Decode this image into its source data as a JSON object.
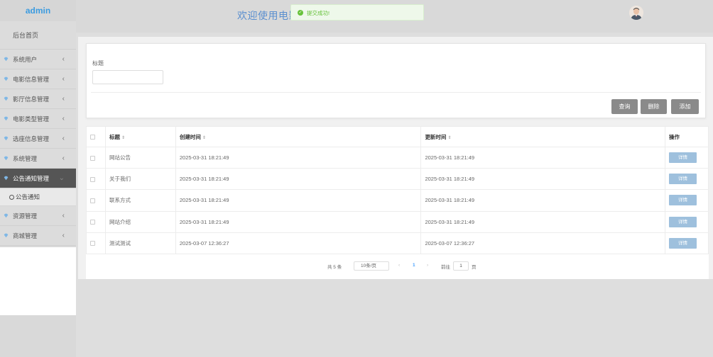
{
  "app": {
    "logo": "admin",
    "welcome": "欢迎使用电影"
  },
  "toast": {
    "message": "提交成功!"
  },
  "sidebar": {
    "home": "后台首页",
    "items": [
      {
        "label": "系统用户"
      },
      {
        "label": "电影信息管理"
      },
      {
        "label": "影厅信息管理"
      },
      {
        "label": "电影类型管理"
      },
      {
        "label": "选座信息管理"
      },
      {
        "label": "系统管理"
      },
      {
        "label": "公告通知管理",
        "active": true
      },
      {
        "label": "资源管理"
      },
      {
        "label": "商城管理"
      }
    ],
    "sub_item": "公告通知"
  },
  "search": {
    "label": "标题",
    "value": "",
    "buttons": {
      "query": "查询",
      "delete": "删除",
      "add": "添加"
    }
  },
  "table": {
    "columns": {
      "title": "标题",
      "created": "创建时间",
      "updated": "更新时间",
      "actions": "操作"
    },
    "rows": [
      {
        "title": "网站公告",
        "created": "2025-03-31 18:21:49",
        "updated": "2025-03-31 18:21:49",
        "action": "详情"
      },
      {
        "title": "关于我们",
        "created": "2025-03-31 18:21:49",
        "updated": "2025-03-31 18:21:49",
        "action": "详情"
      },
      {
        "title": "联系方式",
        "created": "2025-03-31 18:21:49",
        "updated": "2025-03-31 18:21:49",
        "action": "详情"
      },
      {
        "title": "网站介绍",
        "created": "2025-03-31 18:21:49",
        "updated": "2025-03-31 18:21:49",
        "action": "详情"
      },
      {
        "title": "测试测试",
        "created": "2025-03-07 12:36:27",
        "updated": "2025-03-07 12:36:27",
        "action": "详情"
      }
    ]
  },
  "pagination": {
    "total": "共 5 条",
    "page_size": "10条/页",
    "prev": "‹",
    "current": "1",
    "next": "›",
    "goto_label": "前往",
    "goto_value": "1",
    "goto_suffix": "页"
  },
  "colors": {
    "accent": "#409eff",
    "active_menu": "#555555",
    "detail_button": "#9ec0dd",
    "success": "#67c23a"
  }
}
